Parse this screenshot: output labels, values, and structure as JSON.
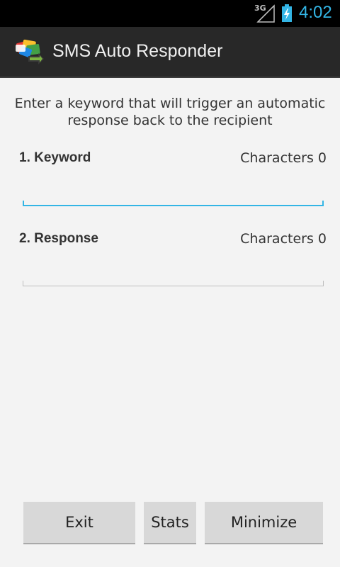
{
  "status_bar": {
    "network_label": "3G",
    "time": "4:02",
    "icons": [
      "signal-icon",
      "battery-charging-icon"
    ],
    "accent_color": "#33b5e5"
  },
  "action_bar": {
    "title": "SMS Auto Responder",
    "icon": "app-logo-icon"
  },
  "main": {
    "intro": "Enter a keyword that will trigger an automatic response back to the recipient",
    "keyword": {
      "label": "1. Keyword",
      "count_label": "Characters 0",
      "value": "",
      "placeholder": ""
    },
    "response": {
      "label": "2. Response",
      "count_label": "Characters 0",
      "value": "",
      "placeholder": ""
    }
  },
  "buttons": {
    "exit": "Exit",
    "stats": "Stats",
    "minimize": "Minimize"
  }
}
